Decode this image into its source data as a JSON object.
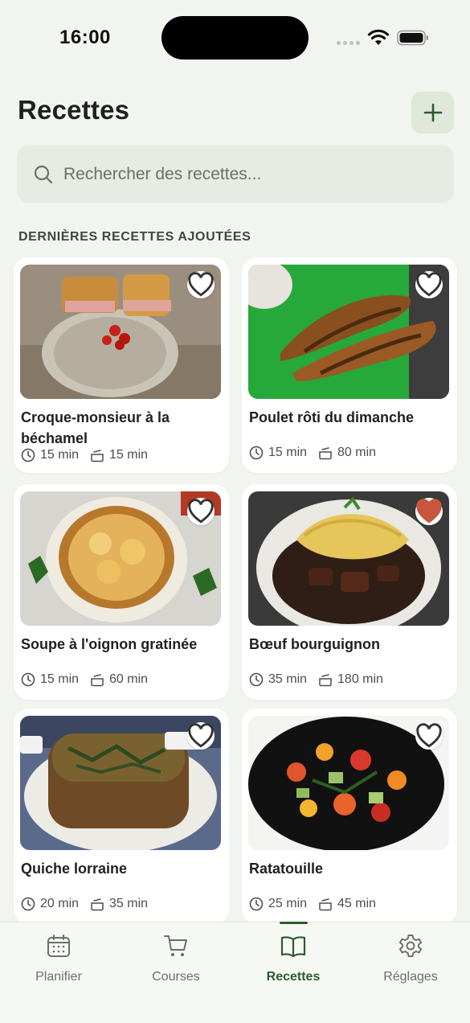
{
  "status_bar": {
    "time": "16:00"
  },
  "header": {
    "title": "Recettes",
    "add_icon": "plus-icon"
  },
  "search": {
    "placeholder": "Rechercher des recettes..."
  },
  "section": {
    "title": "DERNIÈRES RECETTES AJOUTÉES"
  },
  "recipes": [
    {
      "title": "Croque-monsieur à la béchamel",
      "prep": "15 min",
      "cook": "15 min",
      "favorite": false
    },
    {
      "title": "Poulet rôti du dimanche",
      "prep": "15 min",
      "cook": "80 min",
      "favorite": false
    },
    {
      "title": "Soupe à l'oignon gratinée",
      "prep": "15 min",
      "cook": "60 min",
      "favorite": false
    },
    {
      "title": "Bœuf bourguignon",
      "prep": "35 min",
      "cook": "180 min",
      "favorite": true
    },
    {
      "title": "Quiche lorraine",
      "prep": "20 min",
      "cook": "35 min",
      "favorite": false
    },
    {
      "title": "Ratatouille",
      "prep": "25 min",
      "cook": "45 min",
      "favorite": false
    }
  ],
  "nav": {
    "items": [
      {
        "label": "Planifier",
        "icon": "calendar-icon"
      },
      {
        "label": "Courses",
        "icon": "cart-icon"
      },
      {
        "label": "Recettes",
        "icon": "book-icon"
      },
      {
        "label": "Réglages",
        "icon": "gear-icon"
      }
    ],
    "active": "Recettes"
  },
  "colors": {
    "accent": "#2e5a2e",
    "favorite": "#c8553d",
    "background": "#f2f4ef"
  }
}
